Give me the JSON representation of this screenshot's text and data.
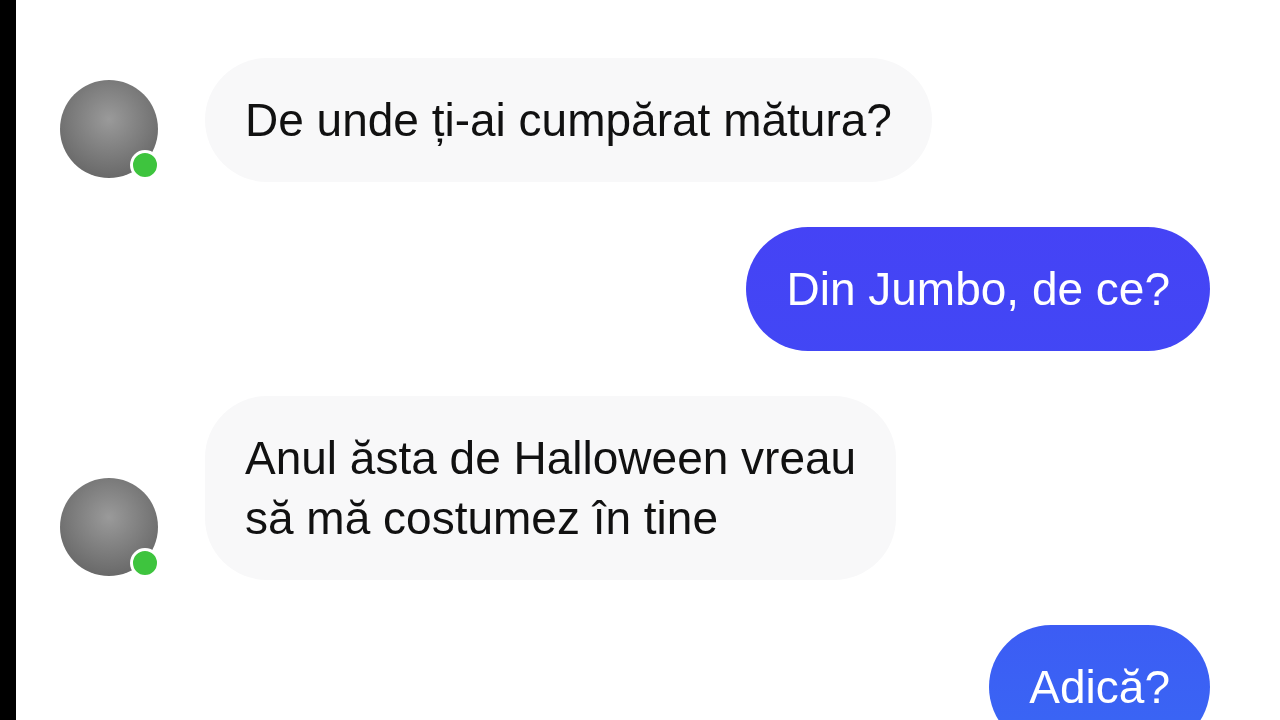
{
  "messages": [
    {
      "kind": "incoming",
      "text": "De unde ți-ai cumpărat mătura?",
      "online": true
    },
    {
      "kind": "outgoing",
      "text": "Din Jumbo, de ce?"
    },
    {
      "kind": "incoming",
      "text": "Anul ăsta de Halloween vreau\nsă mă costumez în tine",
      "online": true
    },
    {
      "kind": "outgoing",
      "text": "Adică?"
    }
  ]
}
